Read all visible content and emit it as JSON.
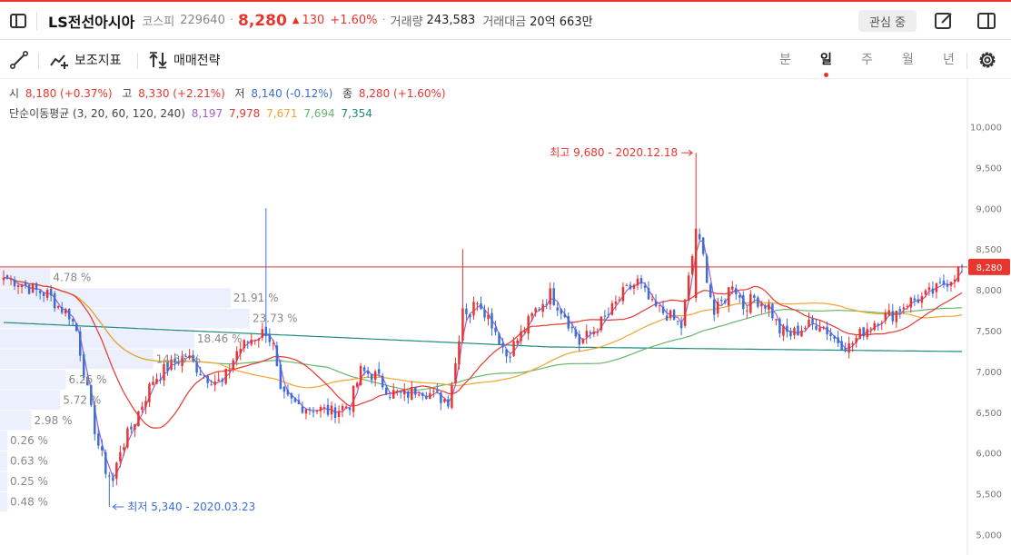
{
  "header": {
    "stock_name": "LS전선아시아",
    "market": "코스피",
    "code": "229640",
    "price": "8,280",
    "change_symbol": "▲",
    "change": "130",
    "change_pct": "+1.60%",
    "volume_label": "거래량",
    "volume": "243,583",
    "amount_label": "거래대금",
    "amount": "20억 663만",
    "watch_label": "관심 중"
  },
  "toolbar": {
    "indicators_label": "보조지표",
    "strategy_label": "매매전략",
    "periods": [
      "분",
      "일",
      "주",
      "월",
      "년"
    ],
    "active_period": "일"
  },
  "legend": {
    "open_label": "시",
    "open_value": "8,180 (+0.37%)",
    "high_label": "고",
    "high_value": "8,330 (+2.21%)",
    "low_label": "저",
    "low_value": "8,140 (-0.12%)",
    "close_label": "종",
    "close_value": "8,280 (+1.60%)",
    "ma_label": "단순이동평균 (3, 20, 60, 120, 240)",
    "ma_values": [
      "8,197",
      "7,978",
      "7,671",
      "7,694",
      "7,354"
    ]
  },
  "colors": {
    "up": "#e8362f",
    "down": "#3b6fd8",
    "ma3": "#a45fd6",
    "ma20": "#e8362f",
    "ma60": "#f2a330",
    "ma120": "#66b66b",
    "ma240": "#1f8a80",
    "volume_profile": "#eceffc"
  },
  "chart_data": {
    "type": "candlestick",
    "y_axis": {
      "ylim": [
        4850,
        10250
      ],
      "ticks": [
        5000,
        5500,
        6000,
        6500,
        7000,
        7500,
        8000,
        8500,
        9000,
        9500,
        10000
      ],
      "tick_labels": [
        "5,000",
        "5,500",
        "6,000",
        "6,500",
        "7,000",
        "7,500",
        "8,000",
        "8,500",
        "9,000",
        "9,500",
        "10,000"
      ],
      "position": "right"
    },
    "current_price": 8280,
    "current_price_label": "8,280",
    "high_annotation": "최고 9,680 - 2020.12.18",
    "low_annotation": "최저 5,340 - 2020.03.23",
    "high_value": 9680,
    "low_value": 5340,
    "close_anchors": [
      [
        0,
        8150
      ],
      [
        4,
        8100
      ],
      [
        8,
        8000
      ],
      [
        12,
        7950
      ],
      [
        15,
        7800
      ],
      [
        18,
        7700
      ],
      [
        20,
        7500
      ],
      [
        22,
        7000
      ],
      [
        24,
        6500
      ],
      [
        26,
        6100
      ],
      [
        28,
        5800
      ],
      [
        30,
        5650
      ],
      [
        32,
        6050
      ],
      [
        35,
        6300
      ],
      [
        38,
        6600
      ],
      [
        41,
        6900
      ],
      [
        45,
        7050
      ],
      [
        50,
        7200
      ],
      [
        55,
        6950
      ],
      [
        60,
        6850
      ],
      [
        64,
        7250
      ],
      [
        68,
        7400
      ],
      [
        72,
        7500
      ],
      [
        74,
        7300
      ],
      [
        76,
        6700
      ],
      [
        80,
        6600
      ],
      [
        85,
        6550
      ],
      [
        90,
        6500
      ],
      [
        95,
        6600
      ],
      [
        98,
        7000
      ],
      [
        102,
        6950
      ],
      [
        106,
        6750
      ],
      [
        110,
        6700
      ],
      [
        114,
        6800
      ],
      [
        118,
        6700
      ],
      [
        122,
        6650
      ],
      [
        124,
        7100
      ],
      [
        126,
        7800
      ],
      [
        128,
        7700
      ],
      [
        130,
        7900
      ],
      [
        134,
        7600
      ],
      [
        138,
        7200
      ],
      [
        142,
        7450
      ],
      [
        146,
        7750
      ],
      [
        150,
        7950
      ],
      [
        154,
        7700
      ],
      [
        158,
        7350
      ],
      [
        162,
        7500
      ],
      [
        166,
        7700
      ],
      [
        170,
        7950
      ],
      [
        174,
        8100
      ],
      [
        178,
        7800
      ],
      [
        182,
        7700
      ],
      [
        186,
        7550
      ],
      [
        190,
        8700
      ],
      [
        192,
        8400
      ],
      [
        195,
        7700
      ],
      [
        198,
        7900
      ],
      [
        200,
        8100
      ],
      [
        203,
        7800
      ],
      [
        206,
        7900
      ],
      [
        210,
        7800
      ],
      [
        213,
        7500
      ],
      [
        216,
        7450
      ],
      [
        220,
        7550
      ],
      [
        224,
        7600
      ],
      [
        228,
        7400
      ],
      [
        232,
        7300
      ],
      [
        236,
        7500
      ],
      [
        240,
        7650
      ],
      [
        244,
        7700
      ],
      [
        248,
        7850
      ],
      [
        252,
        7900
      ],
      [
        256,
        8000
      ],
      [
        260,
        8150
      ],
      [
        263,
        8280
      ]
    ],
    "special_candles": [
      {
        "i": 72,
        "high": 9000
      },
      {
        "i": 126,
        "high": 8500
      },
      {
        "i": 190,
        "open": 7900,
        "high": 9680,
        "close": 8750,
        "low": 7850
      },
      {
        "i": 29,
        "low": 5340
      }
    ],
    "moving_averages": [
      {
        "name": "MA3",
        "period": 3
      },
      {
        "name": "MA20",
        "period": 20
      },
      {
        "name": "MA60",
        "period": 60
      },
      {
        "name": "MA120",
        "period": 120
      },
      {
        "name": "MA240",
        "period": 240
      }
    ],
    "volume_profile": [
      {
        "price": 8150,
        "pct": 4.78,
        "label": "4.78 %"
      },
      {
        "price": 7900,
        "pct": 21.91,
        "label": "21.91 %"
      },
      {
        "price": 7650,
        "pct": 23.73,
        "label": "23.73 %"
      },
      {
        "price": 7400,
        "pct": 18.46,
        "label": "18.46 %"
      },
      {
        "price": 7150,
        "pct": 14.55,
        "label": "14.55 %"
      },
      {
        "price": 6900,
        "pct": 6.26,
        "label": "6.26 %"
      },
      {
        "price": 6650,
        "pct": 5.72,
        "label": "5.72 %"
      },
      {
        "price": 6400,
        "pct": 2.98,
        "label": "2.98 %"
      },
      {
        "price": 6150,
        "pct": 0.26,
        "label": "0.26 %"
      },
      {
        "price": 5900,
        "pct": 0.63,
        "label": "0.63 %"
      },
      {
        "price": 5650,
        "pct": 0.25,
        "label": "0.25 %"
      },
      {
        "price": 5400,
        "pct": 0.48,
        "label": "0.48 %"
      }
    ]
  }
}
